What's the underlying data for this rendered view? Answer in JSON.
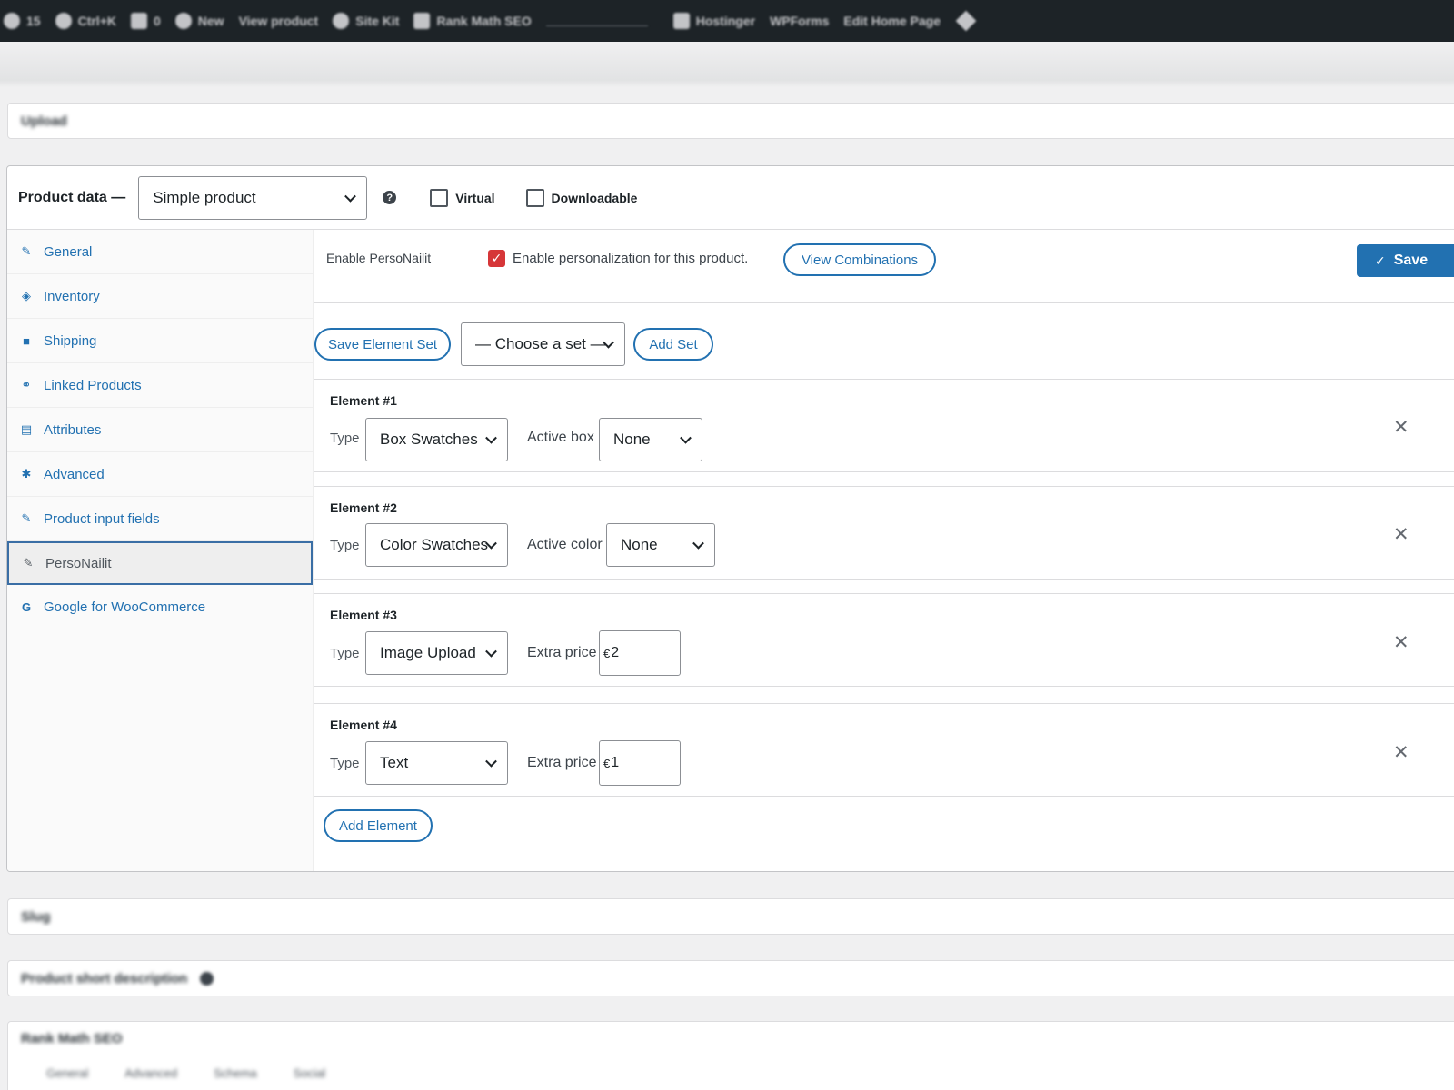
{
  "admin_bar": {
    "items": [
      {
        "icon": "refresh-icon",
        "label": "15"
      },
      {
        "icon": "search-icon",
        "label": "Ctrl+K"
      },
      {
        "icon": "comment-icon",
        "label": "0"
      },
      {
        "icon": "plus-icon",
        "label": "New"
      },
      {
        "icon": "",
        "label": "View product"
      },
      {
        "icon": "site-kit-icon",
        "label": "Site Kit"
      },
      {
        "icon": "rank-math-icon",
        "label": "Rank Math SEO"
      }
    ],
    "items_right": [
      {
        "icon": "hostinger-icon",
        "label": "Hostinger"
      },
      {
        "icon": "",
        "label": "WPForms"
      },
      {
        "icon": "",
        "label": "Edit Home Page"
      }
    ]
  },
  "upload_box": {
    "label": "Upload"
  },
  "product_data": {
    "title": "Product data —",
    "product_type": "Simple product",
    "help": "?",
    "virtual_label": "Virtual",
    "downloadable_label": "Downloadable"
  },
  "tabs": [
    {
      "icon": "wrench-icon",
      "glyph": "✎",
      "label": "General"
    },
    {
      "icon": "tag-icon",
      "glyph": "◈",
      "label": "Inventory"
    },
    {
      "icon": "truck-icon",
      "glyph": "■",
      "label": "Shipping"
    },
    {
      "icon": "link-icon",
      "glyph": "⚭",
      "label": "Linked Products"
    },
    {
      "icon": "list-icon",
      "glyph": "▤",
      "label": "Attributes"
    },
    {
      "icon": "gear-icon",
      "glyph": "✱",
      "label": "Advanced"
    },
    {
      "icon": "wrench-icon",
      "glyph": "✎",
      "label": "Product input fields"
    },
    {
      "icon": "brush-icon",
      "glyph": "✎",
      "label": "PersoNailit"
    },
    {
      "icon": "google-icon",
      "glyph": "G",
      "label": "Google for WooCommerce"
    }
  ],
  "personailit": {
    "enable_label": "Enable PersoNailit",
    "enable_checkbox_label": "Enable personalization for this product.",
    "view_combinations": "View Combinations",
    "save": "Save",
    "save_element_set": "Save Element Set",
    "choose_set": "— Choose a set —",
    "add_set": "Add Set",
    "add_element": "Add Element"
  },
  "elements": [
    {
      "title": "Element #1",
      "type_label": "Type",
      "type": "Box Swatches",
      "field_label": "Active box",
      "field_value": "None"
    },
    {
      "title": "Element #2",
      "type_label": "Type",
      "type": "Color Swatches",
      "field_label": "Active color",
      "field_value": "None"
    },
    {
      "title": "Element #3",
      "type_label": "Type",
      "type": "Image Upload",
      "field_label": "Extra price",
      "currency": "€",
      "field_value": "2"
    },
    {
      "title": "Element #4",
      "type_label": "Type",
      "type": "Text",
      "field_label": "Extra price",
      "currency": "€",
      "field_value": "1"
    }
  ],
  "remove_glyph": "✕",
  "bottom_boxes": {
    "slug": "Slug",
    "short_description": "Product short description",
    "rank_math": "Rank Math SEO",
    "rank_math_tabs": [
      "General",
      "Advanced",
      "Schema",
      "Social"
    ]
  },
  "colors": {
    "accent": "#2271b1",
    "admin_bar": "#1d2327",
    "checkbox_checked": "#d63638"
  }
}
